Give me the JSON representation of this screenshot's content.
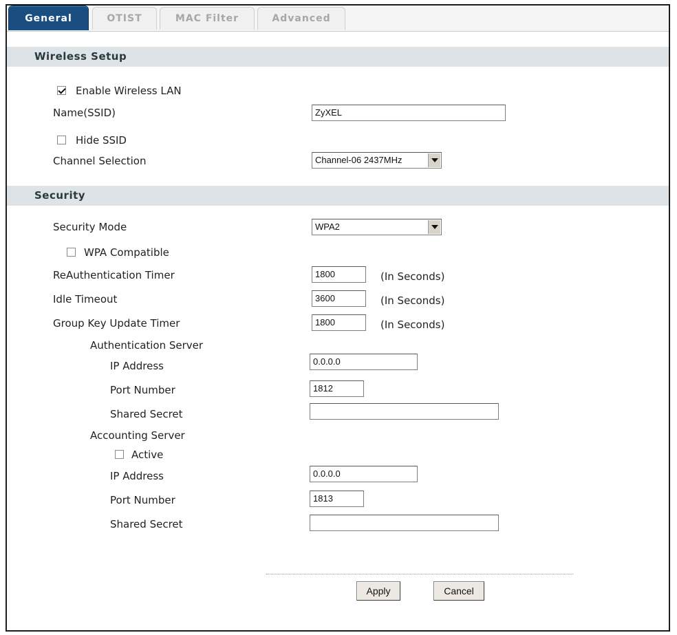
{
  "tabs": [
    "General",
    "OTIST",
    "MAC Filter",
    "Advanced"
  ],
  "sections": {
    "wireless": "Wireless Setup",
    "security": "Security"
  },
  "wireless": {
    "enable_label": "Enable Wireless LAN",
    "enable_checked": true,
    "ssid_label": "Name(SSID)",
    "ssid_value": "ZyXEL",
    "hide_label": "Hide SSID",
    "hide_checked": false,
    "channel_label": "Channel Selection",
    "channel_value": "Channel-06 2437MHz"
  },
  "security": {
    "mode_label": "Security Mode",
    "mode_value": "WPA2",
    "wpa_compat_label": "WPA Compatible",
    "reauth_label": "ReAuthentication Timer",
    "reauth_value": "1800",
    "idle_label": "Idle Timeout",
    "idle_value": "3600",
    "group_label": "Group Key Update Timer",
    "group_value": "1800",
    "unit": "(In Seconds)",
    "auth_server": {
      "title": "Authentication Server",
      "ip_label": "IP Address",
      "ip_value": "0.0.0.0",
      "port_label": "Port Number",
      "port_value": "1812",
      "secret_label": "Shared Secret",
      "secret_value": ""
    },
    "acct_server": {
      "title": "Accounting Server",
      "active_label": "Active",
      "active_checked": false,
      "ip_label": "IP Address",
      "ip_value": "0.0.0.0",
      "port_label": "Port Number",
      "port_value": "1813",
      "secret_label": "Shared Secret",
      "secret_value": ""
    }
  },
  "buttons": {
    "apply": "Apply",
    "cancel": "Cancel"
  }
}
